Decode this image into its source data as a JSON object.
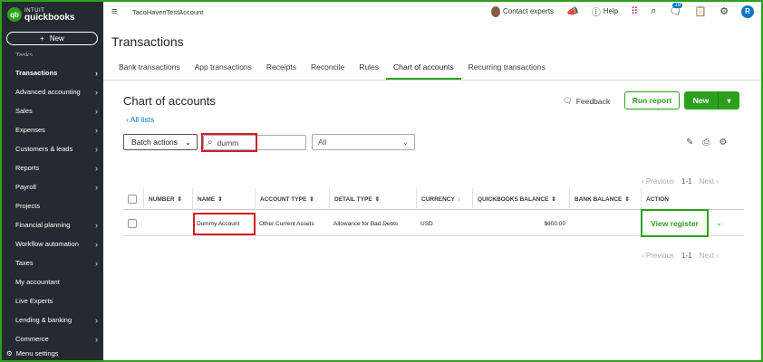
{
  "sidebar": {
    "logo": {
      "intuit": "INTUIT",
      "product": "quickbooks",
      "mark": "qb"
    },
    "new_label": "New",
    "partial_item": "Tasks",
    "items": [
      {
        "label": "Transactions",
        "active": true
      },
      {
        "label": "Advanced accounting"
      },
      {
        "label": "Sales"
      },
      {
        "label": "Expenses"
      },
      {
        "label": "Customers & leads"
      },
      {
        "label": "Reports"
      },
      {
        "label": "Payroll"
      },
      {
        "label": "Projects"
      },
      {
        "label": "Financial planning"
      },
      {
        "label": "Workflow automation"
      },
      {
        "label": "Taxes"
      },
      {
        "label": "My accountant"
      },
      {
        "label": "Live Experts"
      },
      {
        "label": "Lending & banking"
      },
      {
        "label": "Commerce"
      }
    ],
    "menu_settings": "Menu settings"
  },
  "topbar": {
    "company": "TacoHavenTestAccount",
    "contact": "Contact experts",
    "help": "Help",
    "notification_count": "19",
    "user_initial": "R"
  },
  "page": {
    "title": "Transactions",
    "tabs": [
      "Bank transactions",
      "App transactions",
      "Receipts",
      "Reconcile",
      "Rules",
      "Chart of accounts",
      "Recurring transactions"
    ],
    "active_tab": "Chart of accounts"
  },
  "content": {
    "title": "Chart of accounts",
    "all_lists": "All lists",
    "feedback": "Feedback",
    "run_report": "Run report",
    "new_button": "New",
    "batch_actions": "Batch actions",
    "search_value": "dumm",
    "filter_value": "All",
    "pager": {
      "previous": "Previous",
      "range": "1-1",
      "next": "Next"
    }
  },
  "table": {
    "headers": [
      "NUMBER",
      "NAME",
      "ACCOUNT TYPE",
      "DETAIL TYPE",
      "CURRENCY",
      "QUICKBOOKS BALANCE",
      "BANK BALANCE",
      "ACTION"
    ],
    "rows": [
      {
        "number": "",
        "name": "Dummy Account",
        "account_type": "Other Current Assets",
        "detail_type": "Allowance for Bad Debts",
        "currency": "USD",
        "qb_balance": "$600.00",
        "bank_balance": "",
        "action": "View register"
      }
    ]
  },
  "colors": {
    "brand": "#2ca01c",
    "sidebar": "#242a30",
    "link": "#0077c5",
    "highlight": "#d01f28"
  }
}
